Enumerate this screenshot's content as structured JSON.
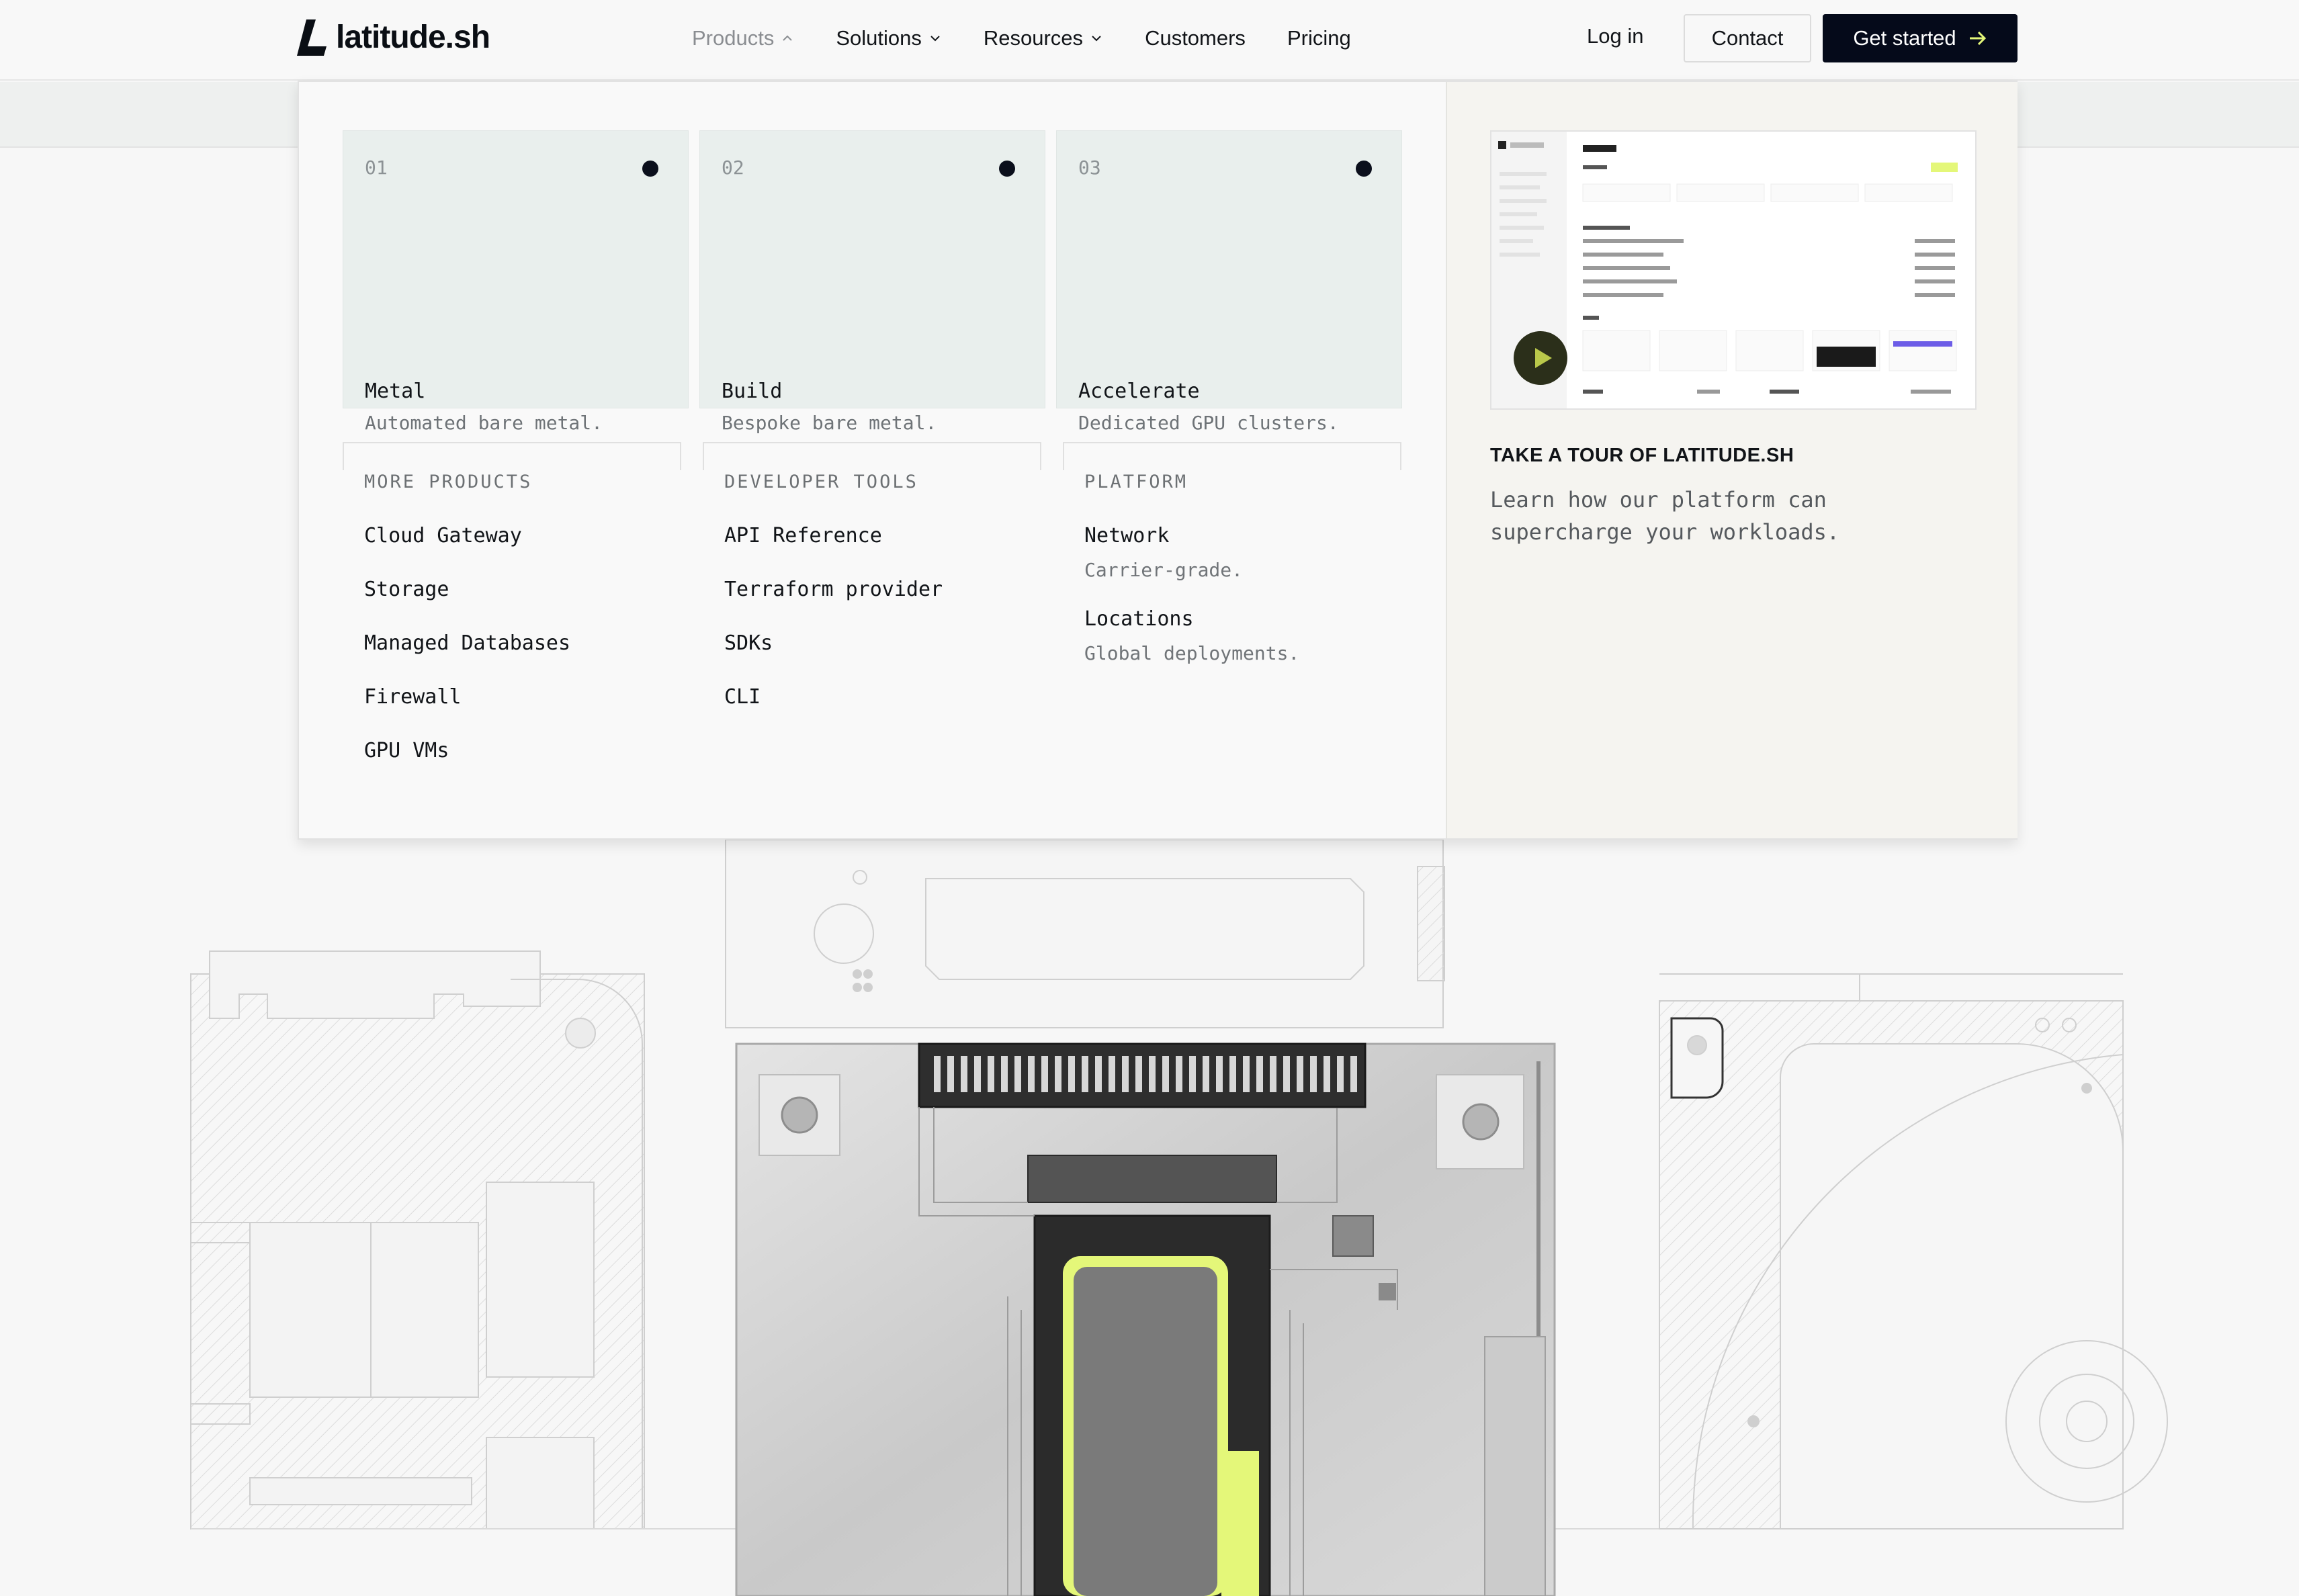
{
  "brand": {
    "name": "latitude.sh"
  },
  "nav": {
    "items": [
      {
        "label": "Products",
        "active": true,
        "dropdown": true
      },
      {
        "label": "Solutions",
        "active": false,
        "dropdown": true
      },
      {
        "label": "Resources",
        "active": false,
        "dropdown": true
      },
      {
        "label": "Customers",
        "active": false,
        "dropdown": false
      },
      {
        "label": "Pricing",
        "active": false,
        "dropdown": false
      }
    ],
    "login": "Log in",
    "contact": "Contact",
    "get_started": "Get started"
  },
  "menu": {
    "cards": [
      {
        "num": "01",
        "title": "Metal",
        "desc": "Automated bare metal."
      },
      {
        "num": "02",
        "title": "Build",
        "desc": "Bespoke bare metal."
      },
      {
        "num": "03",
        "title": "Accelerate",
        "desc": "Dedicated GPU clusters."
      }
    ],
    "more_products": {
      "heading": "MORE PRODUCTS",
      "links": [
        "Cloud Gateway",
        "Storage",
        "Managed Databases",
        "Firewall",
        "GPU VMs"
      ]
    },
    "developer_tools": {
      "heading": "DEVELOPER TOOLS",
      "links": [
        "API Reference",
        "Terraform provider",
        "SDKs",
        "CLI"
      ]
    },
    "platform": {
      "heading": "PLATFORM",
      "items": [
        {
          "title": "Network",
          "desc": "Carrier-grade."
        },
        {
          "title": "Locations",
          "desc": "Global deployments."
        }
      ]
    },
    "tour": {
      "title": "TAKE A TOUR OF LATITUDE.SH",
      "desc": "Learn how our platform can supercharge your workloads."
    }
  },
  "colors": {
    "accent_lime": "#e4f779",
    "dark": "#050a1a",
    "card_bg": "#e9efed"
  }
}
